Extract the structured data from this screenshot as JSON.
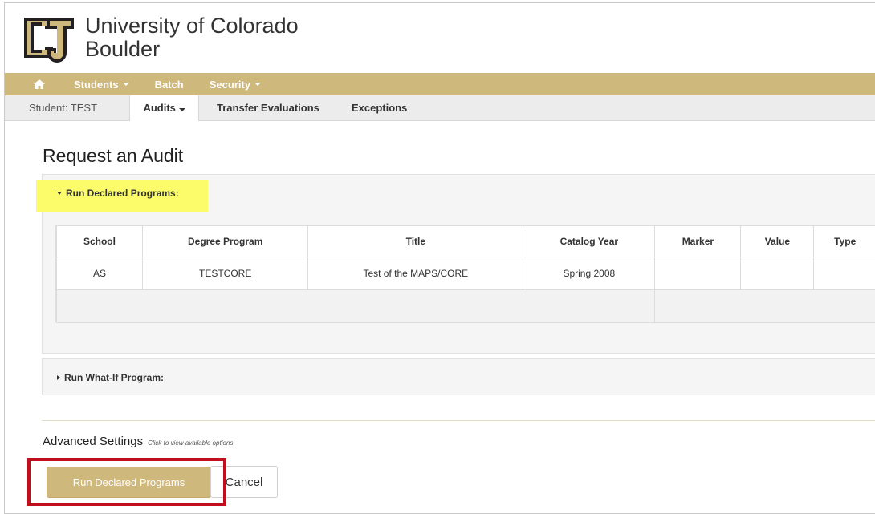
{
  "brand": {
    "line1": "University of Colorado",
    "line2": "Boulder",
    "logo": "CU-logo"
  },
  "topnav": {
    "home_icon": "home-icon",
    "students": "Students",
    "batch": "Batch",
    "security": "Security"
  },
  "subnav": {
    "student": "Student: TEST",
    "audits": "Audits",
    "transfer": "Transfer Evaluations",
    "exceptions": "Exceptions"
  },
  "page": {
    "title": "Request an Audit"
  },
  "declared": {
    "heading": "Run Declared Programs:",
    "columns": [
      "School",
      "Degree Program",
      "Title",
      "Catalog Year",
      "Marker",
      "Value",
      "Type"
    ],
    "rows": [
      [
        "AS",
        "TESTCORE",
        "Test of the MAPS/CORE",
        "Spring 2008",
        "",
        "",
        ""
      ]
    ]
  },
  "whatif": {
    "heading": "Run What-If Program:"
  },
  "advanced": {
    "title": "Advanced Settings",
    "hint": "Click to view available options"
  },
  "buttons": {
    "run": "Run Declared Programs",
    "cancel": "Cancel"
  },
  "colors": {
    "gold": "#cfb87c",
    "highlight": "#fcfc6a",
    "callout": "#c0101e"
  }
}
